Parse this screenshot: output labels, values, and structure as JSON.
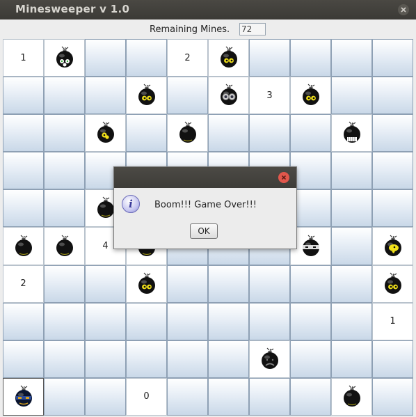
{
  "window": {
    "title": "Minesweeper v 1.0"
  },
  "header": {
    "label": "Remaining Mines.",
    "count": "72"
  },
  "board": {
    "rows": [
      [
        {
          "t": "open",
          "v": "1"
        },
        {
          "t": "mine",
          "icon": "skull-mine-icon"
        },
        {
          "t": "closed"
        },
        {
          "t": "closed"
        },
        {
          "t": "open",
          "v": "2"
        },
        {
          "t": "mine",
          "icon": "cool-mine-icon"
        },
        {
          "t": "closed"
        },
        {
          "t": "closed"
        },
        {
          "t": "closed"
        },
        {
          "t": "closed"
        }
      ],
      [
        {
          "t": "closed"
        },
        {
          "t": "closed"
        },
        {
          "t": "closed"
        },
        {
          "t": "mine",
          "icon": "cool-mine-icon"
        },
        {
          "t": "closed"
        },
        {
          "t": "mine",
          "icon": "goggles-mine-icon"
        },
        {
          "t": "open",
          "v": "3"
        },
        {
          "t": "mine",
          "icon": "cool-mine-icon"
        },
        {
          "t": "closed"
        },
        {
          "t": "closed"
        }
      ],
      [
        {
          "t": "closed"
        },
        {
          "t": "closed"
        },
        {
          "t": "mine",
          "icon": "wink-mine-icon"
        },
        {
          "t": "closed"
        },
        {
          "t": "mine",
          "icon": "plain-mine-icon"
        },
        {
          "t": "closed"
        },
        {
          "t": "closed"
        },
        {
          "t": "closed"
        },
        {
          "t": "mine",
          "icon": "grin-mine-icon"
        },
        {
          "t": "closed"
        }
      ],
      [
        {
          "t": "closed"
        },
        {
          "t": "closed"
        },
        {
          "t": "closed"
        },
        {
          "t": "closed"
        },
        {
          "t": "closed"
        },
        {
          "t": "closed"
        },
        {
          "t": "closed"
        },
        {
          "t": "closed"
        },
        {
          "t": "closed"
        },
        {
          "t": "closed"
        }
      ],
      [
        {
          "t": "closed"
        },
        {
          "t": "closed"
        },
        {
          "t": "mine",
          "icon": "plain-mine-icon"
        },
        {
          "t": "closed"
        },
        {
          "t": "closed"
        },
        {
          "t": "closed"
        },
        {
          "t": "closed"
        },
        {
          "t": "closed"
        },
        {
          "t": "closed"
        },
        {
          "t": "closed"
        }
      ],
      [
        {
          "t": "mine",
          "icon": "plain-mine-icon"
        },
        {
          "t": "mine",
          "icon": "plain-mine-icon"
        },
        {
          "t": "open",
          "v": "4"
        },
        {
          "t": "mine",
          "icon": "plain-mine-icon"
        },
        {
          "t": "closed"
        },
        {
          "t": "closed"
        },
        {
          "t": "closed"
        },
        {
          "t": "mine",
          "icon": "ninja-mine-icon"
        },
        {
          "t": "closed"
        },
        {
          "t": "mine",
          "icon": "tongue-mine-icon"
        }
      ],
      [
        {
          "t": "open",
          "v": "2"
        },
        {
          "t": "closed"
        },
        {
          "t": "closed"
        },
        {
          "t": "mine",
          "icon": "cool-mine-icon"
        },
        {
          "t": "closed"
        },
        {
          "t": "closed"
        },
        {
          "t": "closed"
        },
        {
          "t": "closed"
        },
        {
          "t": "closed"
        },
        {
          "t": "mine",
          "icon": "cool-mine-icon"
        }
      ],
      [
        {
          "t": "closed"
        },
        {
          "t": "closed"
        },
        {
          "t": "closed"
        },
        {
          "t": "closed"
        },
        {
          "t": "closed"
        },
        {
          "t": "closed"
        },
        {
          "t": "closed"
        },
        {
          "t": "closed"
        },
        {
          "t": "closed"
        },
        {
          "t": "open",
          "v": "1"
        }
      ],
      [
        {
          "t": "closed"
        },
        {
          "t": "closed"
        },
        {
          "t": "closed"
        },
        {
          "t": "closed"
        },
        {
          "t": "closed"
        },
        {
          "t": "closed"
        },
        {
          "t": "mine",
          "icon": "frown-mine-icon"
        },
        {
          "t": "closed"
        },
        {
          "t": "closed"
        },
        {
          "t": "closed"
        }
      ],
      [
        {
          "t": "hit",
          "icon": "exploded-mine-icon"
        },
        {
          "t": "closed"
        },
        {
          "t": "closed"
        },
        {
          "t": "open",
          "v": "0"
        },
        {
          "t": "closed"
        },
        {
          "t": "closed"
        },
        {
          "t": "closed"
        },
        {
          "t": "closed"
        },
        {
          "t": "mine",
          "icon": "plain-mine-icon"
        },
        {
          "t": "closed"
        }
      ]
    ]
  },
  "dialog": {
    "message": "Boom!!! Game Over!!!",
    "ok_label": "OK",
    "info_icon": "info-icon",
    "info_glyph": "i"
  },
  "colors": {
    "titlebar": "#3b3a36",
    "tile_top": "#ffffff",
    "tile_bottom": "#c9d8e8",
    "tile_border": "#8ea0b4",
    "dialog_close": "#e2574c",
    "mine_yellow": "#f2e21a"
  }
}
